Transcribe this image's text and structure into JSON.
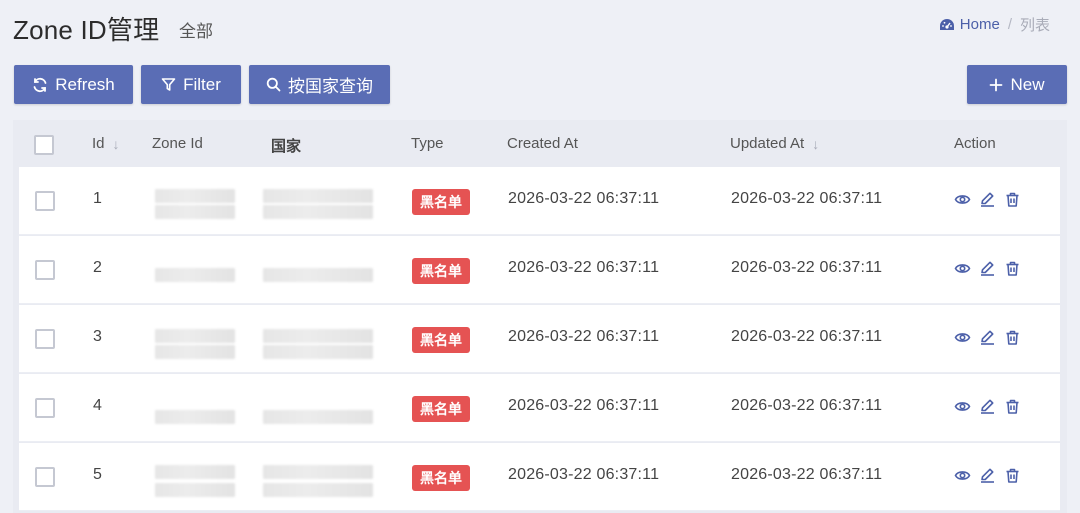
{
  "header": {
    "title": "Zone ID管理",
    "subtitle": "全部"
  },
  "breadcrumb": {
    "home": "Home",
    "separator": "/",
    "current": "列表"
  },
  "toolbar": {
    "refresh_label": "Refresh",
    "filter_label": "Filter",
    "search_country_label": "按国家查询",
    "new_label": "New"
  },
  "table": {
    "columns": {
      "id": "Id",
      "zone_id": "Zone Id",
      "country": "国家",
      "type": "Type",
      "created_at": "Created At",
      "updated_at": "Updated At",
      "action": "Action"
    },
    "rows": [
      {
        "id": "1",
        "type": "黑名单",
        "created_at": "2026-03-22 06:37:11",
        "updated_at": "2026-03-22 06:37:11"
      },
      {
        "id": "2",
        "type": "黑名单",
        "created_at": "2026-03-22 06:37:11",
        "updated_at": "2026-03-22 06:37:11"
      },
      {
        "id": "3",
        "type": "黑名单",
        "created_at": "2026-03-22 06:37:11",
        "updated_at": "2026-03-22 06:37:11"
      },
      {
        "id": "4",
        "type": "黑名单",
        "created_at": "2026-03-22 06:37:11",
        "updated_at": "2026-03-22 06:37:11"
      },
      {
        "id": "5",
        "type": "黑名单",
        "created_at": "2026-03-22 06:37:11",
        "updated_at": "2026-03-22 06:37:11"
      }
    ]
  },
  "colors": {
    "primary": "#5a6db5",
    "link": "#4c60a9",
    "danger": "#e55353",
    "background": "#eef0f6"
  },
  "icons": [
    "dashboard-icon",
    "refresh-icon",
    "filter-icon",
    "search-icon",
    "plus-icon",
    "sort-down-icon",
    "eye-icon",
    "edit-icon",
    "trash-icon"
  ]
}
